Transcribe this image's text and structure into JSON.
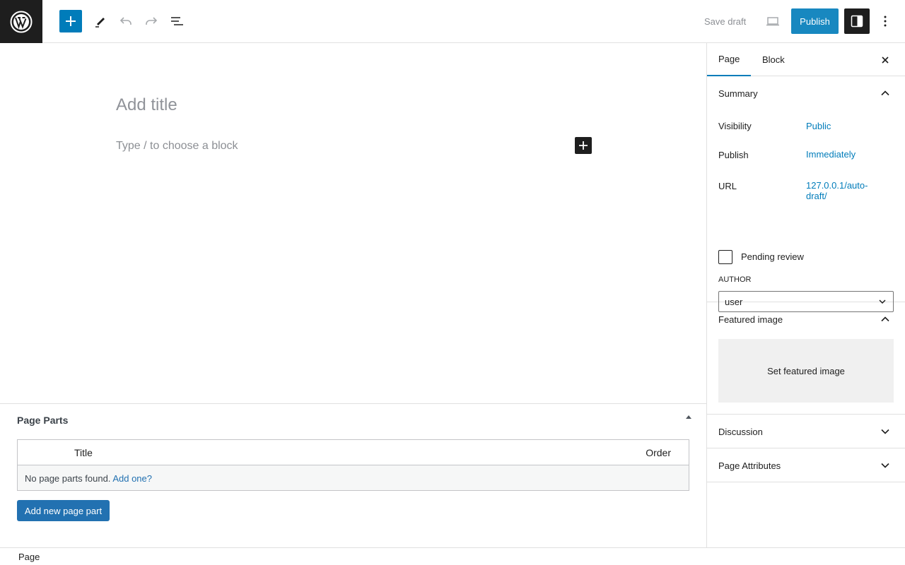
{
  "toolbar": {
    "logo_icon": "wordpress-logo-icon",
    "inserter_icon": "plus-icon",
    "save_draft_label": "Save draft",
    "publish_label": "Publish",
    "accent": "#007cba"
  },
  "editor": {
    "title_placeholder": "Add title",
    "block_placeholder": "Type / to choose a block"
  },
  "metabox": {
    "title": "Page Parts",
    "columns": [
      "Title",
      "Order"
    ],
    "empty_text": "No page parts found.",
    "empty_link": "Add one?",
    "add_button_label": "Add new page part"
  },
  "footer": {
    "breadcrumb": "Page"
  },
  "sidebar": {
    "tabs": [
      "Page",
      "Block"
    ],
    "active_tab": "Page",
    "summary": {
      "title": "Summary",
      "visibility_label": "Visibility",
      "visibility_value": "Public",
      "publish_label": "Publish",
      "publish_value": "Immediately",
      "url_label": "URL",
      "url_value_line1": "127.0.0.1/auto-",
      "url_value_line2": "draft/",
      "pending_label": "Pending review",
      "author_label": "AUTHOR",
      "author_value": "user"
    },
    "featured": {
      "title": "Featured image",
      "button_label": "Set featured image"
    },
    "discussion_title": "Discussion",
    "attributes_title": "Page Attributes"
  }
}
